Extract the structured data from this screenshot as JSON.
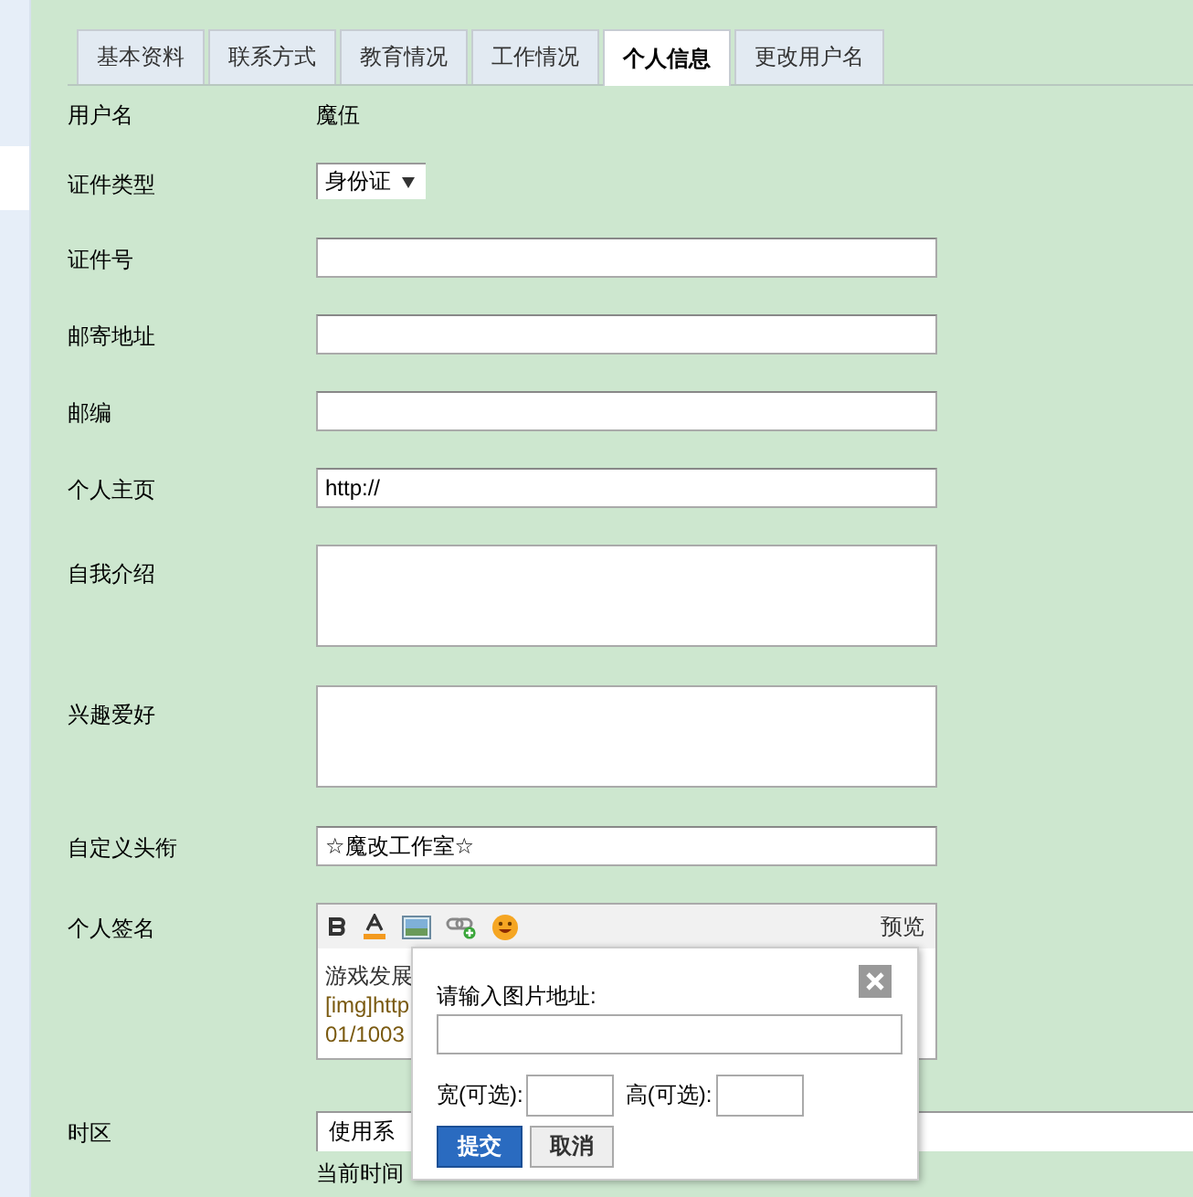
{
  "tabs": [
    {
      "label": "基本资料",
      "selected": false
    },
    {
      "label": "联系方式",
      "selected": false
    },
    {
      "label": "教育情况",
      "selected": false
    },
    {
      "label": "工作情况",
      "selected": false
    },
    {
      "label": "个人信息",
      "selected": true
    },
    {
      "label": "更改用户名",
      "selected": false
    }
  ],
  "fields": [
    {
      "kind": "text",
      "label": "用户名",
      "value": "魔伍"
    },
    {
      "kind": "select",
      "label": "证件类型",
      "value": "身份证"
    },
    {
      "kind": "input",
      "label": "证件号"
    },
    {
      "kind": "input",
      "label": "邮寄地址"
    },
    {
      "kind": "input",
      "label": "邮编"
    },
    {
      "kind": "input",
      "label": "个人主页",
      "value": "http://"
    },
    {
      "kind": "textarea",
      "label": "自我介绍"
    },
    {
      "kind": "textarea",
      "label": "兴趣爱好"
    },
    {
      "kind": "input",
      "label": "自定义头衔",
      "value": "☆魔改工作室☆"
    },
    {
      "kind": "editor",
      "label": "个人签名",
      "preview": "预览",
      "lines": [
        "游戏发展",
        "[img]http",
        "01/1003"
      ]
    },
    {
      "kind": "timezone",
      "label": "时区",
      "value": "使用系",
      "note": "当前时间"
    }
  ],
  "dialog": {
    "prompt": "请输入图片地址:",
    "width_label": "宽(可选):",
    "height_label": "高(可选):",
    "submit": "提交",
    "cancel": "取消"
  }
}
